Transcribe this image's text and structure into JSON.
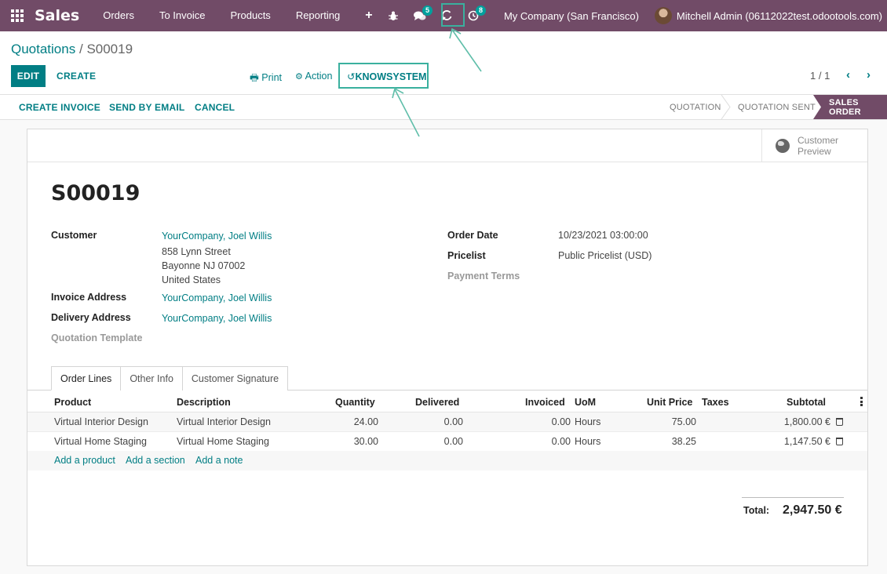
{
  "navbar": {
    "brand": "Sales",
    "menu": [
      "Orders",
      "To Invoice",
      "Products",
      "Reporting"
    ],
    "plus": "+",
    "chat_badge": "5",
    "activity_badge": "8",
    "company": "My Company (San Francisco)",
    "user": "Mitchell Admin (06112022test.odootools.com)"
  },
  "control": {
    "breadcrumb_parent": "Quotations",
    "breadcrumb_sep": "/",
    "breadcrumb_current": "S00019",
    "edit": "EDIT",
    "create": "CREATE",
    "print": "Print",
    "action": "Action",
    "knowsystem": "KNOWSYSTEM",
    "pager": "1 / 1"
  },
  "statusbar": {
    "buttons": [
      "CREATE INVOICE",
      "SEND BY EMAIL",
      "CANCEL"
    ],
    "stages": [
      "QUOTATION",
      "QUOTATION SENT",
      "SALES ORDER"
    ]
  },
  "sheet": {
    "customer_preview": [
      "Customer",
      "Preview"
    ],
    "title": "S00019",
    "fields": {
      "customer_label": "Customer",
      "customer_name": "YourCompany, Joel Willis",
      "address_1": "858 Lynn Street",
      "address_2": "Bayonne NJ 07002",
      "address_3": "United States",
      "invoice_address_label": "Invoice Address",
      "invoice_address": "YourCompany, Joel Willis",
      "delivery_address_label": "Delivery Address",
      "delivery_address": "YourCompany, Joel Willis",
      "quotation_template_label": "Quotation Template",
      "order_date_label": "Order Date",
      "order_date": "10/23/2021 03:00:00",
      "pricelist_label": "Pricelist",
      "pricelist": "Public Pricelist (USD)",
      "payment_terms_label": "Payment Terms"
    },
    "tabs": [
      "Order Lines",
      "Other Info",
      "Customer Signature"
    ],
    "table": {
      "headers": [
        "Product",
        "Description",
        "Quantity",
        "Delivered",
        "Invoiced",
        "UoM",
        "Unit Price",
        "Taxes",
        "Subtotal"
      ],
      "rows": [
        [
          "Virtual Interior Design",
          "Virtual Interior Design",
          "24.00",
          "0.00",
          "0.00",
          "Hours",
          "75.00",
          "",
          "1,800.00 €"
        ],
        [
          "Virtual Home Staging",
          "Virtual Home Staging",
          "30.00",
          "0.00",
          "0.00",
          "Hours",
          "38.25",
          "",
          "1,147.50 €"
        ]
      ],
      "add_links": [
        "Add a product",
        "Add a section",
        "Add a note"
      ]
    },
    "total_label": "Total:",
    "total_value": "2,947.50 €"
  },
  "colors": {
    "brand": "#714b67",
    "accent": "#017e84",
    "highlight": "#3ab09e"
  }
}
